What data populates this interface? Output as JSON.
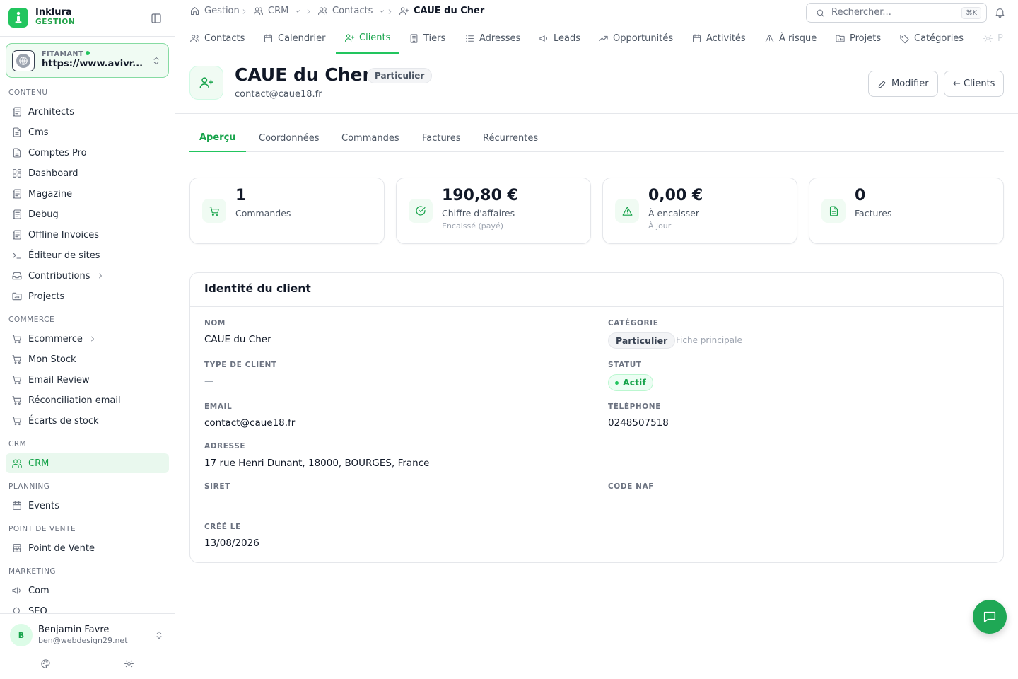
{
  "brand": {
    "name": "Inklura",
    "sub": "GESTION"
  },
  "site": {
    "label": "FITAMANT",
    "url": "https://www.avivr..."
  },
  "sidebar": {
    "sections": {
      "contenu": "CONTENU",
      "commerce": "COMMERCE",
      "crm": "CRM",
      "planning": "PLANNING",
      "pos": "POINT DE VENTE",
      "marketing": "MARKETING"
    },
    "items": {
      "architects": "Architects",
      "cms": "Cms",
      "comptes_pro": "Comptes Pro",
      "dashboard": "Dashboard",
      "magazine": "Magazine",
      "debug": "Debug",
      "offline_invoices": "Offline Invoices",
      "editeur": "Éditeur de sites",
      "contributions": "Contributions",
      "projects": "Projects",
      "ecommerce": "Ecommerce",
      "mon_stock": "Mon Stock",
      "email_review": "Email Review",
      "reconciliation": "Réconciliation email",
      "ecarts": "Écarts de stock",
      "crm": "CRM",
      "events": "Events",
      "point_de_vente": "Point de Vente",
      "com": "Com",
      "seo": "SEO"
    }
  },
  "user": {
    "initial": "B",
    "name": "Benjamin Favre",
    "email": "ben@webdesign29.net"
  },
  "breadcrumb": {
    "gestion": "Gestion",
    "crm": "CRM",
    "contacts": "Contacts",
    "current": "CAUE du Cher"
  },
  "search": {
    "placeholder": "Rechercher...",
    "shortcut": "⌘K"
  },
  "module_tabs": {
    "contacts": "Contacts",
    "calendrier": "Calendrier",
    "clients": "Clients",
    "tiers": "Tiers",
    "adresses": "Adresses",
    "leads": "Leads",
    "opportunites": "Opportunités",
    "activites": "Activités",
    "a_risque": "À risque",
    "projets": "Projets",
    "categories": "Catégories",
    "more": "P"
  },
  "client": {
    "name": "CAUE du Cher",
    "badge": "Particulier",
    "email": "contact@caue18.fr",
    "edit_label": "Modifier",
    "back_label": "← Clients"
  },
  "page_tabs": {
    "apercu": "Aperçu",
    "coordonnees": "Coordonnées",
    "commandes": "Commandes",
    "factures": "Factures",
    "recurrentes": "Récurrentes"
  },
  "stats": {
    "commandes": {
      "value": "1",
      "label": "Commandes"
    },
    "ca": {
      "value": "190,80 €",
      "label": "Chiffre d'affaires",
      "sub": "Encaissé (payé)"
    },
    "encaisser": {
      "value": "0,00 €",
      "label": "À encaisser",
      "sub": "À jour"
    },
    "factures": {
      "value": "0",
      "label": "Factures"
    }
  },
  "identity": {
    "title": "Identité du client",
    "nom_label": "NOM",
    "nom": "CAUE du Cher",
    "categorie_label": "CATÉGORIE",
    "categorie": "Particulier",
    "categorie_note": "Fiche principale",
    "type_label": "TYPE DE CLIENT",
    "type": "—",
    "statut_label": "STATUT",
    "statut": "Actif",
    "email_label": "EMAIL",
    "email": "contact@caue18.fr",
    "telephone_label": "TÉLÉPHONE",
    "telephone": "0248507518",
    "adresse_label": "ADRESSE",
    "adresse": "17 rue Henri Dunant, 18000, BOURGES, France",
    "siret_label": "SIRET",
    "siret": "—",
    "naf_label": "CODE NAF",
    "naf": "—",
    "cree_label": "CRÉÉ LE",
    "cree": "13/08/2026"
  },
  "colors": {
    "accent": "#22c55e",
    "accent_dark": "#16a34a",
    "border": "#e5e7eb"
  }
}
